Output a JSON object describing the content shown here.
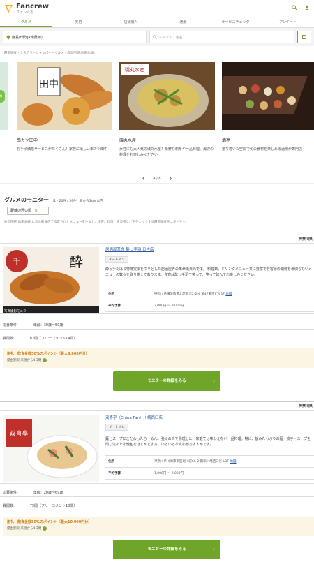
{
  "header": {
    "logo": "Fancrew",
    "logo_sub": "ファンくる",
    "search_icon": "search-icon",
    "user_icon": "user-icon"
  },
  "tabs": [
    "グルメ",
    "美容",
    "店頭購入",
    "通販",
    "サービスチェック",
    "アンケート"
  ],
  "search": {
    "area": "鹿島田駅(JR南武線)",
    "genre_placeholder": "ジャンル・店名"
  },
  "breadcrumb": "覆面調査 › ミステリーショッパー・グルメ › 鹿島田駅(JR南武線)",
  "carousel": {
    "cards": [
      {
        "title": "串カツ田中",
        "desc": "お手頃価格サービスがたくさん！家族に嬉しい串カツ田中"
      },
      {
        "title": "磯丸水産",
        "desc": "女性にも大人気の磯丸水産！新鮮な刺身や一品料理、海辺の料理をお楽しみください"
      },
      {
        "title": "酒亭",
        "desc": "落ち着いた空間で旬の食材を楽しめる酒場が専門店"
      }
    ],
    "pager": "4 / 8"
  },
  "section": {
    "title": "グルメのモニター",
    "sub": "（1 - 20件 / 59件）駅から5km 以内",
    "sort": "距離の近い順",
    "note": "鹿島田駅(JR南武線)にある飲食店で指定されたメニューを注文し、接客、料理、清潔感などをチェックする覆面調査モニターです。"
  },
  "shops": [
    {
      "pref": "神奈川県",
      "name": "居酒屋革命 酔っ手羽 日吉店",
      "tag": "イートイン",
      "desc": "酔っ手羽は長特徴実事をウリとした居酒屋界の革命風貴元です。 料理数、ドリンクメニュー共に豊富でお客様の期待を裏切らないメニューの数々を取り揃えております。今宵は酔っ手羽で笑って、笑って飲んでお楽しみください。",
      "addr_label": "住所",
      "addr": "神奈川県横浜市港北区日吉2-2-4 第47東京ビル1F",
      "map": "地図",
      "price_label": "平均予算",
      "price": "2,000円 〜 3,000円",
      "cond_label": "応募条件:",
      "cond": "年齢：30歳〜59歳",
      "q_label": "質問数:",
      "q": "82問（フリーコメント14問）",
      "reward": "謝礼：飲食金額50%のポイント（最大6,000円分）",
      "reward_sub": "提出期限:来週から4日間",
      "cta": "モニターの詳細をみる",
      "badge": "写真撮影モニター"
    },
    {
      "pref": "神奈川県",
      "name": "双喜亭（China Fan）川崎西口店",
      "tag": "イートイン",
      "desc": "麺とスープにこだわったら一めん。強火の炎で熟理した、家庭では味わえない一品料理。特に、旨みたっぷりの麺・餃子・スープを閉じ込めた小籠包をはじめとする、いろいろな点心がおすすめです。",
      "addr_label": "住所",
      "addr": "神奈川県川崎市幸区堀川町66-2 興和川崎西口ビル1F",
      "map": "地図",
      "price_label": "平均予算",
      "price": "1,000円 〜 2,000円",
      "cond_label": "応募条件:",
      "cond": "年齢：20歳〜69歳",
      "q_label": "質問数:",
      "q": "75問（フリーコメント10問）",
      "reward": "謝礼：飲食金額50%のポイント（最大10,000円分）",
      "reward_sub": "提出期限:来週から4日間",
      "cta": "モニターの詳細をみる"
    }
  ],
  "colors": {
    "accent": "#7aa33a",
    "cta": "#6fa528",
    "reward": "#d08020",
    "link": "#2a5aa0"
  }
}
